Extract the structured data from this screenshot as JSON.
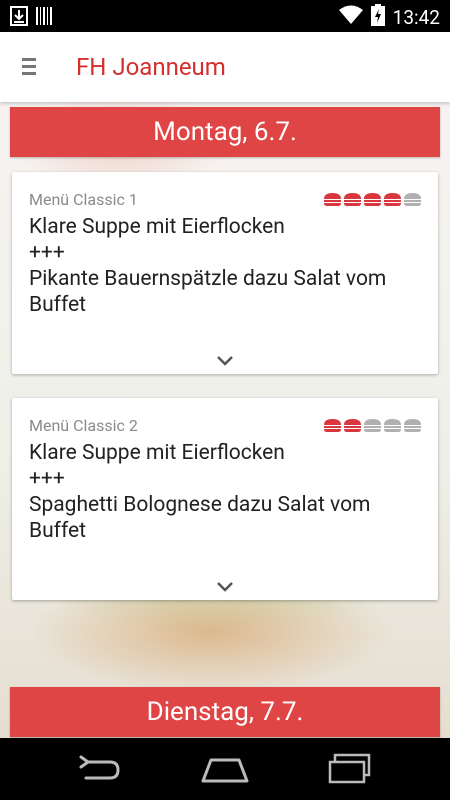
{
  "status_bar": {
    "time": "13:42",
    "icons": [
      "download-icon",
      "barcode-icon",
      "wifi-icon",
      "battery-charging-icon"
    ]
  },
  "app_bar": {
    "title": "FH Joanneum",
    "menu_icon": "hamburger-menu-icon"
  },
  "days": [
    {
      "label": "Montag, 6.7.",
      "menus": [
        {
          "label": "Menü Classic 1",
          "rating": 4,
          "rating_max": 5,
          "soup": "Klare Suppe mit Eierflocken",
          "separator": "+++",
          "main_line1": "Pikante Bauernspätzle dazu Salat vom",
          "main_line2": "Buffet"
        },
        {
          "label": "Menü Classic 2",
          "rating": 2,
          "rating_max": 5,
          "soup": "Klare Suppe mit Eierflocken",
          "separator": "+++",
          "main_line1": "Spaghetti Bolognese dazu Salat vom",
          "main_line2": "Buffet"
        }
      ]
    },
    {
      "label": "Dienstag, 7.7."
    }
  ],
  "colors": {
    "accent": "#e04545",
    "title_red": "#d32f2f",
    "rating_filled": "#d9363e",
    "rating_empty": "#b0b0b0"
  },
  "nav_bar": {
    "icons": [
      "back-icon",
      "home-icon",
      "recents-icon"
    ]
  }
}
